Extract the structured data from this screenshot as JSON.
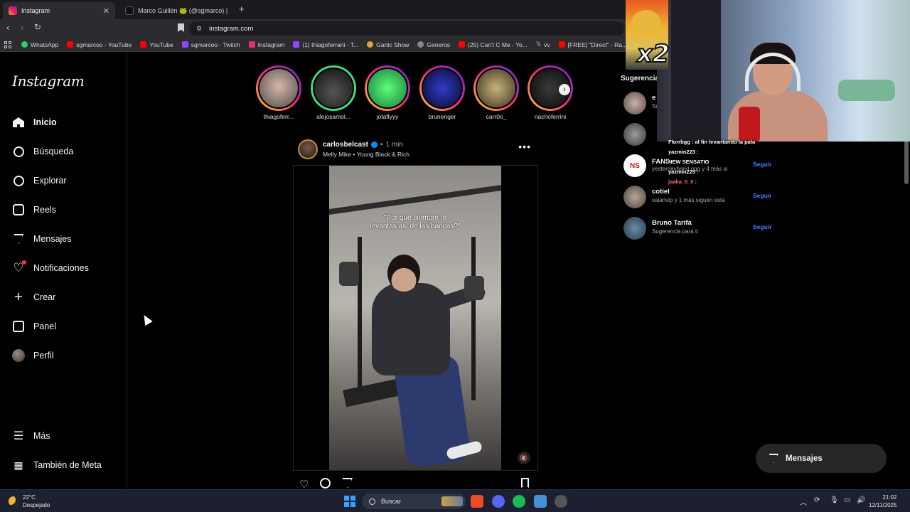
{
  "browser": {
    "tabs": [
      {
        "label": "Instagram",
        "active": true
      },
      {
        "label": "Marco Guillén 🐸 (@sgmarco) | TikTo",
        "active": false
      }
    ],
    "url": "instagram.com",
    "bookmarks": [
      {
        "label": "WhatsApp",
        "color": "#25d366"
      },
      {
        "label": "sgmarcoo - YouTube",
        "color": "#ff0000"
      },
      {
        "label": "YouTube",
        "color": "#ff0000"
      },
      {
        "label": "sgmarcoo - Twitch",
        "color": "#9146ff"
      },
      {
        "label": "Instagram",
        "color": "#e1306c"
      },
      {
        "label": "(1) thiagoferrarii - T...",
        "color": "#9146ff"
      },
      {
        "label": "Gartic Show",
        "color": "#d9a441"
      },
      {
        "label": "Generos",
        "color": "#888888"
      },
      {
        "label": "(25) Can't C Me - Yo...",
        "color": "#ff0000"
      },
      {
        "label": "vv",
        "color": "#ffffff"
      },
      {
        "label": "[FREE] \"Direct\" - Ra...",
        "color": "#ff0000"
      }
    ]
  },
  "sidebar": {
    "logo": "Instagram",
    "items": [
      {
        "label": "Inicio",
        "icon": "home-icon"
      },
      {
        "label": "Búsqueda",
        "icon": "search-icon"
      },
      {
        "label": "Explorar",
        "icon": "compass-icon"
      },
      {
        "label": "Reels",
        "icon": "reels-icon"
      },
      {
        "label": "Mensajes",
        "icon": "messenger-icon"
      },
      {
        "label": "Notificaciones",
        "icon": "heart-icon"
      },
      {
        "label": "Crear",
        "icon": "plus-icon"
      },
      {
        "label": "Panel",
        "icon": "dashboard-icon"
      },
      {
        "label": "Perfil",
        "icon": "avatar-icon"
      },
      {
        "label": "Más",
        "icon": "menu-icon"
      },
      {
        "label": "También de Meta",
        "icon": "meta-icon"
      }
    ]
  },
  "stories": [
    {
      "name": "thiagoferr...",
      "ring": "gradient"
    },
    {
      "name": "alejosamol...",
      "ring": "green"
    },
    {
      "name": "jotaflyyy",
      "ring": "gradient"
    },
    {
      "name": "brunenger",
      "ring": "gradient"
    },
    {
      "name": "carr0o_",
      "ring": "gradient"
    },
    {
      "name": "nachoferrini",
      "ring": "gradient"
    }
  ],
  "post": {
    "username": "carlosbelcast",
    "time": "1 min",
    "audio": "Melly Mike • Young Black & Rich",
    "caption_line1": "\"Por qué siempre te",
    "caption_line2": "levantas así de las bancas?\""
  },
  "suggestions": {
    "title": "Sugerencia",
    "follow_label": "Seguir",
    "items": [
      {
        "name": "e",
        "sub": "Su"
      },
      {
        "name": "",
        "sub": ""
      },
      {
        "name": "FANS",
        "sub": "yesterdayband.ggg y 4 más si"
      },
      {
        "name": "cotiel",
        "sub": "saianvip y 1 más siguen esta"
      },
      {
        "name": "Bruno Tarifa",
        "sub": "Sugerencia para ti"
      }
    ]
  },
  "messages_button": "Mensajes",
  "stream": {
    "multiplier": "x2",
    "chat": [
      {
        "user": "Florrbgg",
        "text": ": al fin levantando la pala"
      },
      {
        "user": "yazmin223",
        "text": ":"
      },
      {
        "user": "NEW SENSATIO",
        "text": ""
      },
      {
        "user": "yazmin223",
        "text": ":"
      },
      {
        "user": "jaaka_0_0",
        "text": ":"
      }
    ]
  },
  "taskbar": {
    "temperature": "22°C",
    "weather": "Despejado",
    "search_placeholder": "Buscar",
    "time": "21:02",
    "date": "12/11/2025"
  }
}
